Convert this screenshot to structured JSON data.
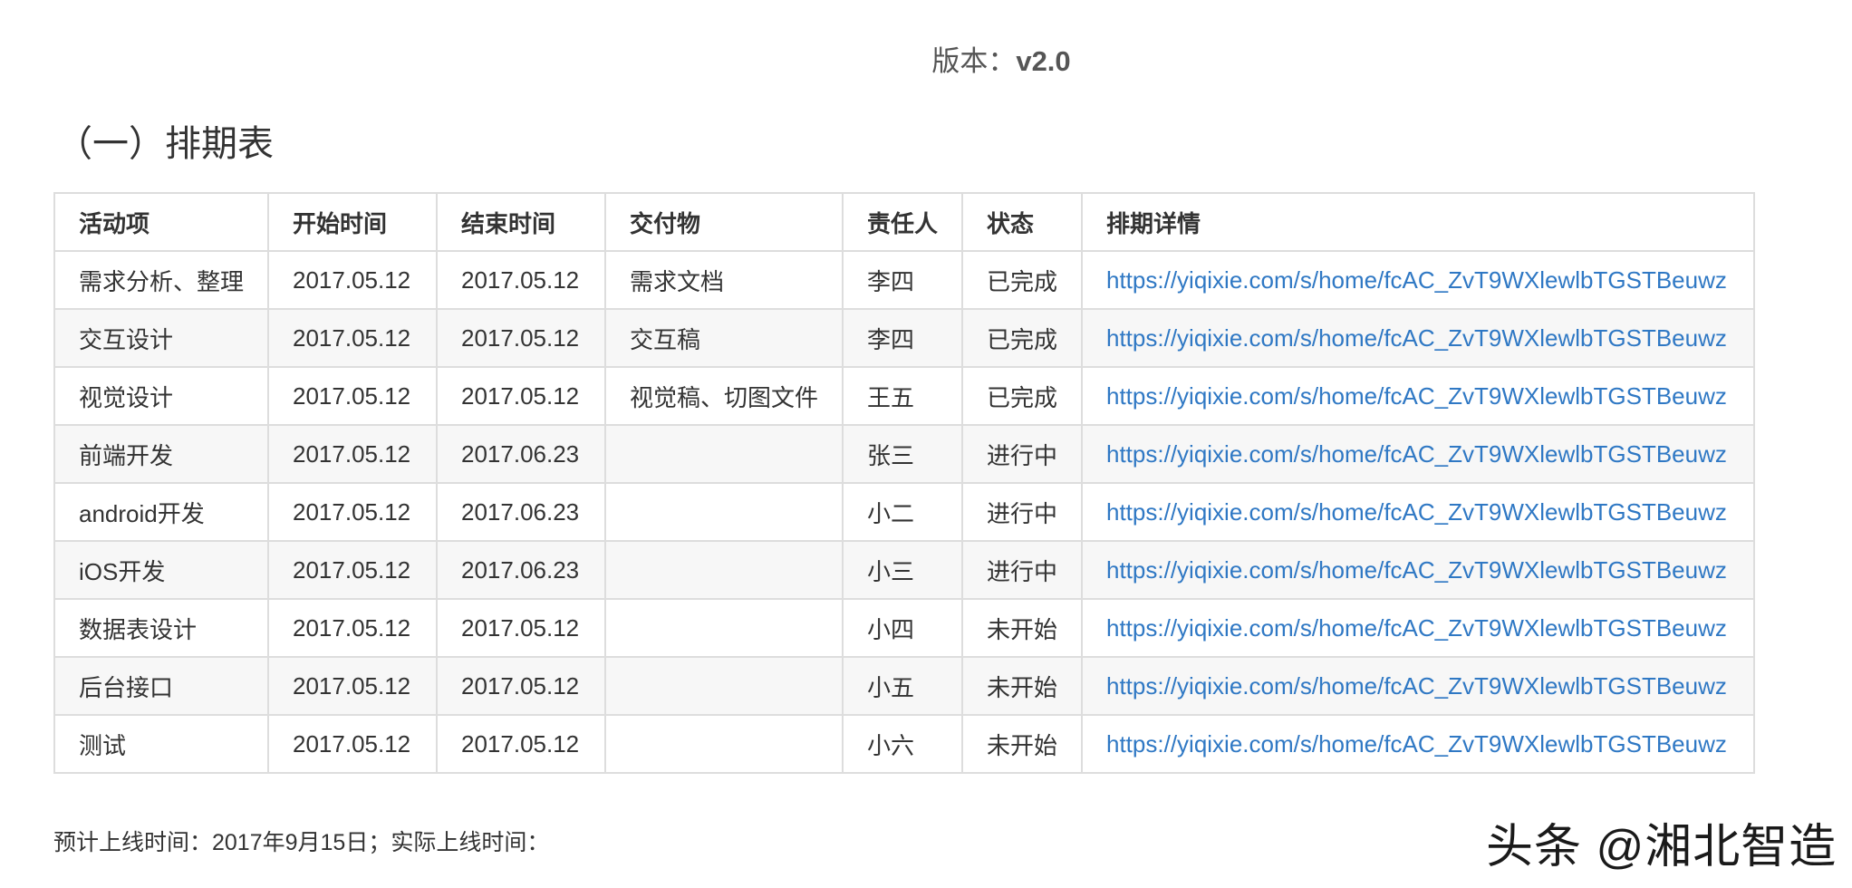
{
  "header": {
    "version_label": "版本：",
    "version_value": "v2.0"
  },
  "section": {
    "title": "（一）排期表"
  },
  "table": {
    "columns": [
      "活动项",
      "开始时间",
      "结束时间",
      "交付物",
      "责任人",
      "状态",
      "排期详情"
    ],
    "rows": [
      {
        "activity": "需求分析、整理",
        "start": "2017.05.12",
        "end": "2017.05.12",
        "deliverable": "需求文档",
        "owner": "李四",
        "status": "已完成",
        "link": "https://yiqixie.com/s/home/fcAC_ZvT9WXlewlbTGSTBeuwz"
      },
      {
        "activity": "交互设计",
        "start": "2017.05.12",
        "end": "2017.05.12",
        "deliverable": "交互稿",
        "owner": "李四",
        "status": "已完成",
        "link": "https://yiqixie.com/s/home/fcAC_ZvT9WXlewlbTGSTBeuwz"
      },
      {
        "activity": "视觉设计",
        "start": "2017.05.12",
        "end": "2017.05.12",
        "deliverable": "视觉稿、切图文件",
        "owner": "王五",
        "status": "已完成",
        "link": "https://yiqixie.com/s/home/fcAC_ZvT9WXlewlbTGSTBeuwz"
      },
      {
        "activity": "前端开发",
        "start": "2017.05.12",
        "end": "2017.06.23",
        "deliverable": "",
        "owner": "张三",
        "status": "进行中",
        "link": "https://yiqixie.com/s/home/fcAC_ZvT9WXlewlbTGSTBeuwz"
      },
      {
        "activity": "android开发",
        "start": "2017.05.12",
        "end": "2017.06.23",
        "deliverable": "",
        "owner": "小二",
        "status": "进行中",
        "link": "https://yiqixie.com/s/home/fcAC_ZvT9WXlewlbTGSTBeuwz"
      },
      {
        "activity": "iOS开发",
        "start": "2017.05.12",
        "end": "2017.06.23",
        "deliverable": "",
        "owner": "小三",
        "status": "进行中",
        "link": "https://yiqixie.com/s/home/fcAC_ZvT9WXlewlbTGSTBeuwz"
      },
      {
        "activity": "数据表设计",
        "start": "2017.05.12",
        "end": "2017.05.12",
        "deliverable": "",
        "owner": "小四",
        "status": "未开始",
        "link": "https://yiqixie.com/s/home/fcAC_ZvT9WXlewlbTGSTBeuwz"
      },
      {
        "activity": "后台接口",
        "start": "2017.05.12",
        "end": "2017.05.12",
        "deliverable": "",
        "owner": "小五",
        "status": "未开始",
        "link": "https://yiqixie.com/s/home/fcAC_ZvT9WXlewlbTGSTBeuwz"
      },
      {
        "activity": "测试",
        "start": "2017.05.12",
        "end": "2017.05.12",
        "deliverable": "",
        "owner": "小六",
        "status": "未开始",
        "link": "https://yiqixie.com/s/home/fcAC_ZvT9WXlewlbTGSTBeuwz"
      }
    ]
  },
  "footer": {
    "launch_note": "预计上线时间：2017年9月15日；实际上线时间：",
    "watermark": "头条 @湘北智造"
  },
  "colors": {
    "link": "#2f78c4",
    "border": "#dddddd",
    "stripe": "#f7f7f7"
  }
}
